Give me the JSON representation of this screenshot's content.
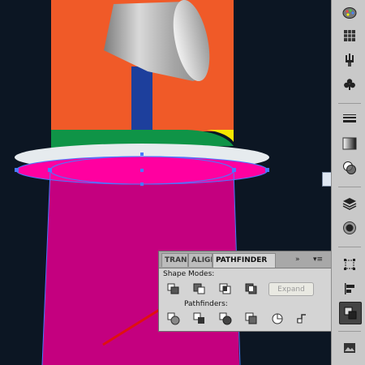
{
  "panel": {
    "tabs": [
      {
        "label": "TRAN"
      },
      {
        "label": "ALIGN"
      },
      {
        "label": "PATHFINDER"
      }
    ],
    "collapse_icon": "»",
    "menu_icon": "▾≡",
    "shape_modes_label": "Shape Modes:",
    "pathfinders_label": "Pathfinders:",
    "expand_label": "Expand",
    "shape_mode_buttons": [
      "unite-icon",
      "minus-front-icon",
      "intersect-icon",
      "exclude-icon"
    ],
    "pathfinder_buttons": [
      "divide-icon",
      "trim-icon",
      "merge-icon",
      "crop-icon",
      "outline-icon",
      "minus-back-icon"
    ]
  },
  "toolstrip": {
    "tools": [
      "color-palette-icon",
      "swatches-grid-icon",
      "brushes-icon",
      "symbols-club-icon",
      "stroke-lines-icon",
      "gradient-icon",
      "transparency-icon",
      "layers-icon",
      "appearance-icon",
      "transform-icon",
      "align-icon",
      "pathfinder-icon",
      "image-icon"
    ],
    "active_tool": "pathfinder-icon"
  },
  "colors": {
    "canvas": "#0c1623",
    "orange": "#f05a28",
    "magenta": "#c4007f",
    "selection": "#4a78ff",
    "arrow": "#e01010"
  }
}
